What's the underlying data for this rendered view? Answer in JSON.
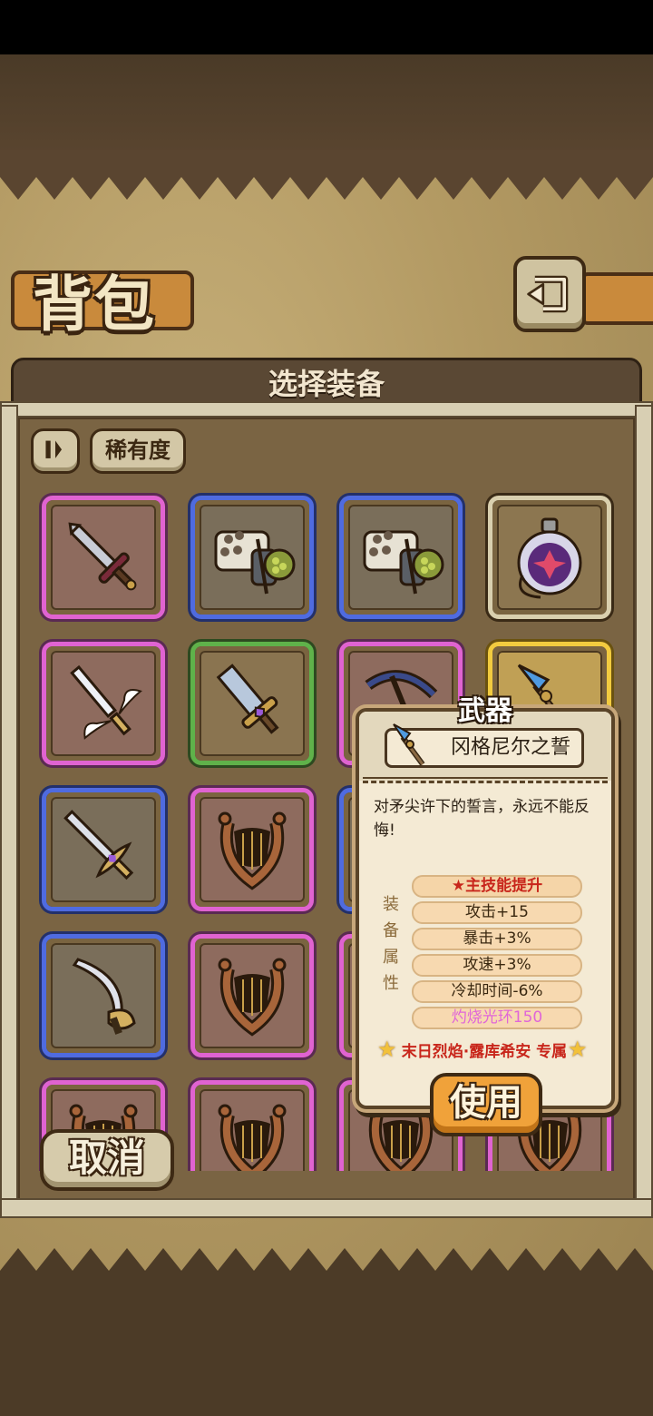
{
  "header": {
    "title": "背包"
  },
  "panel": {
    "title": "选择装备",
    "sort_icon": "pause-sort-icon",
    "rarity_label": "稀有度"
  },
  "items": [
    {
      "rarity": "pink",
      "icon": "sword-icon"
    },
    {
      "rarity": "blue",
      "icon": "gatling-gun-icon"
    },
    {
      "rarity": "blue",
      "icon": "gatling-gun-icon"
    },
    {
      "rarity": "brown",
      "icon": "potion-flask-icon"
    },
    {
      "rarity": "pink",
      "icon": "winged-sword-icon"
    },
    {
      "rarity": "green",
      "icon": "gem-sword-icon"
    },
    {
      "rarity": "pink",
      "icon": "scythe-icon"
    },
    {
      "rarity": "gold",
      "icon": "spear-icon"
    },
    {
      "rarity": "blue",
      "icon": "long-sword-icon"
    },
    {
      "rarity": "pink",
      "icon": "lyre-icon"
    },
    {
      "rarity": "blue",
      "icon": "hidden-item-icon"
    },
    {
      "rarity": "blue",
      "icon": "hidden-item-icon"
    },
    {
      "rarity": "blue",
      "icon": "saber-icon"
    },
    {
      "rarity": "pink",
      "icon": "lyre-icon"
    },
    {
      "rarity": "pink",
      "icon": "hidden-item-icon"
    },
    {
      "rarity": "pink",
      "icon": "hidden-item-icon"
    },
    {
      "rarity": "pink",
      "icon": "lyre-icon"
    },
    {
      "rarity": "pink",
      "icon": "lyre-icon"
    },
    {
      "rarity": "pink",
      "icon": "lyre-icon"
    },
    {
      "rarity": "pink",
      "icon": "lyre-icon"
    }
  ],
  "tooltip": {
    "category": "武器",
    "name": "冈格尼尔之誓",
    "description": "对矛尖许下的誓言，永远不能反悔!",
    "side_label": [
      "装",
      "备",
      "属",
      "性"
    ],
    "main_skill": "★主技能提升",
    "stats": [
      "攻击+15",
      "暴击+3%",
      "攻速+3%",
      "冷却时间-6%"
    ],
    "special_stat": "灼烧光环150",
    "exclusive": "末日烈焰·露库希安 专属",
    "use_label": "使用"
  },
  "cancel_label": "取消",
  "colors": {
    "pink": "#e063d1",
    "blue": "#4f6be0",
    "green": "#5fb24a",
    "gold": "#f2cb3f",
    "accent": "#f0a23a"
  }
}
